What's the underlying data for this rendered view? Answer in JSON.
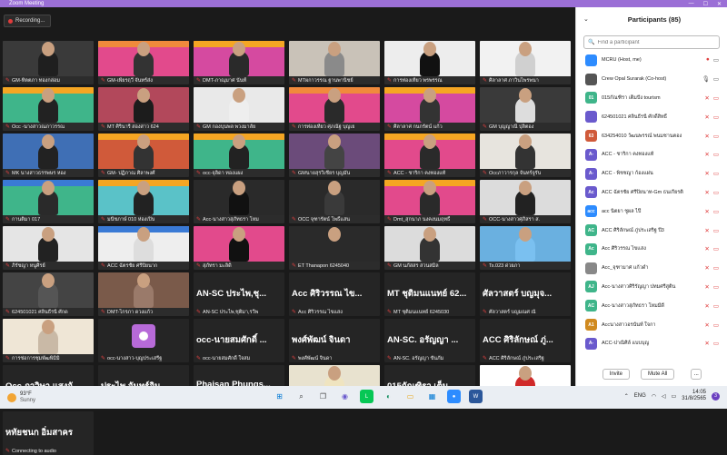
{
  "window": {
    "title": "Zoom Meeting"
  },
  "recording": {
    "label": "Recording..."
  },
  "tiles": [
    {
      "name": "GM-ทิตตภา ทองกล่อม",
      "type": "video",
      "bg": "#3a3a3a",
      "banner": "",
      "shirt": "#1f1f1f"
    },
    {
      "name": "GM-เพียรฤวี จันทร์ส่ง",
      "type": "video",
      "bg": "#e24a8c",
      "banner": "#f08a3c",
      "shirt": "#333"
    },
    {
      "name": "DMT-ภาณุมาศ นันท์ี",
      "type": "video",
      "bg": "#d54aa0",
      "banner": "#f5a623",
      "shirt": "#2a2a2a"
    },
    {
      "name": "MTผกาวรรณ ฐานพานิชย์",
      "type": "video",
      "bg": "#c9c2b8",
      "banner": "",
      "shirt": "#8a8a8a"
    },
    {
      "name": "การท่องเที่ยว พรพรรณ",
      "type": "video",
      "bg": "#ededed",
      "banner": "",
      "shirt": "#111"
    },
    {
      "name": "ศิลาลาศ ภาวินไพรพนา",
      "type": "video",
      "bg": "#f2f2f2",
      "banner": "",
      "shirt": "#d0d0d0"
    },
    {
      "name": "Occ -นางสาวณภาวรรณ",
      "type": "video",
      "bg": "#3fb58a",
      "banner": "#f5a623",
      "shirt": "#222"
    },
    {
      "name": "MT ศิรินารี สองสาว 624",
      "type": "video",
      "bg": "#b2485b",
      "banner": "",
      "shirt": "#1c1c1c"
    },
    {
      "name": "GM กองบุนพล พวงมาลัย",
      "type": "video",
      "bg": "#e9e9e9",
      "banner": "",
      "shirt": "#eee"
    },
    {
      "name": "การท่องเที่ยว ศุภณัฐ บุญเย",
      "type": "video",
      "bg": "#e24a8c",
      "banner": "#f08a3c",
      "shirt": "#2a2a2a"
    },
    {
      "name": "ศิลาลาศ กนกรัตน์ แก้ว",
      "type": "video",
      "bg": "#d54aa0",
      "banner": "#f5a623",
      "shirt": "#333"
    },
    {
      "name": "GM บุญญาณี ปุลิตอง",
      "type": "video",
      "bg": "#3a3a3a",
      "banner": "",
      "shirt": "#ddd"
    },
    {
      "name": "MK นางสาวธรรพษร หอง",
      "type": "video",
      "bg": "#3f6fb5",
      "banner": "",
      "shirt": "#222"
    },
    {
      "name": "GM- ปฏิภาณ ศิลาพงศ์",
      "type": "video",
      "bg": "#d05a3a",
      "banner": "#f5a623",
      "shirt": "#333"
    },
    {
      "name": "occ-จุลิดา ทองแผง",
      "type": "video",
      "bg": "#3fb58a",
      "banner": "#f5a623",
      "shirt": "#222"
    },
    {
      "name": "GMนายสุรวิเชียร บุญมั่น",
      "type": "video",
      "bg": "#6b4b7a",
      "banner": "",
      "shirt": "#444"
    },
    {
      "name": "ACC - ชาริกา คงทองแท้",
      "type": "video",
      "bg": "#e24a8c",
      "banner": "#f5a623",
      "shirt": "#2a2a2a"
    },
    {
      "name": "Occภาวารกุล จันทร์จูรัน",
      "type": "video",
      "bg": "#e7e4de",
      "banner": "",
      "shirt": "#333"
    },
    {
      "name": "กานติมา 017",
      "type": "video",
      "bg": "#3fb58a",
      "banner": "#3a7ad5",
      "shirt": "#2a2a2a"
    },
    {
      "name": "มนีชภาษ์ 010 ห่องเปิน",
      "type": "video",
      "bg": "#5ac2c8",
      "banner": "#f5a623",
      "shirt": "#222"
    },
    {
      "name": "Acc-นางสาวสุภัทธรา โหม",
      "type": "video",
      "bg": "#2a2a2a",
      "banner": "",
      "shirt": "#111"
    },
    {
      "name": "OCC จุฑารัตน์ โพธิ์แสน",
      "type": "video",
      "bg": "#2a2a2a",
      "banner": "",
      "shirt": "#3a3a3a"
    },
    {
      "name": "Dmt_สุกนาภ นงคงนมฤทธิ์",
      "type": "video",
      "bg": "#e24a8c",
      "banner": "#f5a623",
      "shirt": "#2a2a2a"
    },
    {
      "name": "OCC-นางสาวศุภิสรา ส.",
      "type": "video",
      "bg": "#dcdcdc",
      "banner": "",
      "shirt": "#222"
    },
    {
      "name": "ภิรัชญา หนูศิรย์",
      "type": "video",
      "bg": "#e5e5e5",
      "banner": "",
      "shirt": "#222"
    },
    {
      "name": "ACC ฉัตรชัย ศรีปิยนาก",
      "type": "video",
      "bg": "#eeeeee",
      "banner": "#3a7ad5",
      "shirt": "#ddd"
    },
    {
      "name": "สุภัทรา มะลิดิ",
      "type": "video",
      "bg": "#e24a8c",
      "banner": "",
      "shirt": "#111"
    },
    {
      "name": "ET Thanapon 6245040",
      "type": "video",
      "bg": "#2a2a2a",
      "banner": "",
      "shirt": "#2a2a2a"
    },
    {
      "name": "GM นภัสสร สวนสมิล",
      "type": "video",
      "bg": "#dcdcdc",
      "banner": "",
      "shirt": "#333"
    },
    {
      "name": "Ts.023 ด่วยภา",
      "type": "video",
      "bg": "#6ab0e0",
      "banner": "",
      "shirt": "#7ac0f0"
    },
    {
      "name": "624501021 ศลินธีรนี ศักด",
      "type": "video",
      "bg": "#444",
      "banner": "",
      "shirt": "#555"
    },
    {
      "name": "DMT-ไกรภา ดวงแก้ว",
      "type": "video",
      "bg": "#7a5a4a",
      "banner": "",
      "shirt": "#9a7a6a"
    },
    {
      "name": "AN-SC ประไพ,ชุติมา,รวีพ",
      "type": "text",
      "big": "AN-SC ประไพ,ชุ..."
    },
    {
      "name": "Acc ศิริวรรณ ไขแสง",
      "type": "text",
      "big": "Acc ศิริวรรณ ไข..."
    },
    {
      "name": "MT ชุติมนแนทย์ 6245030",
      "type": "text",
      "big": "MT ชุติมนแนทย์ 62..."
    },
    {
      "name": "ศัลวาสตร์ บญมณศ ณั",
      "type": "text",
      "big": "ศัลวาสตร์ บญมุจ..."
    },
    {
      "name": "การช่อการชุมพัฒพิมิมิ",
      "type": "video",
      "bg": "#efe6d6",
      "banner": "",
      "shirt": "#c9b9a6"
    },
    {
      "name": "occ-นางสาว-บุญประเสรีฐ",
      "type": "avatar"
    },
    {
      "name": "occ-นายสมศักดิ์ ใจสม",
      "type": "text",
      "big": "occ-นายสมศักดิ์ ..."
    },
    {
      "name": "พงศ์พัฒน์ จินดา",
      "type": "text",
      "big": "พงศ์พัฒน์ จินดา"
    },
    {
      "name": "AN-SC. อรัญญา ขันภัม",
      "type": "text",
      "big": "AN-SC. อรัญญา ..."
    },
    {
      "name": "ACC ศิริลักษณ์ ภู่ประเสริฐ",
      "type": "text",
      "big": "ACC ศิริลักษณ์ ภู่..."
    },
    {
      "name": "Occ ภาวิษา แสงจันทร์",
      "type": "text",
      "big": "Occ ภาวิษา แสงจั..."
    },
    {
      "name": "ประไพ จันทร์อินทร์ ศิลาศ",
      "type": "text",
      "big": "ประไพ จันทร์อิน..."
    },
    {
      "name": "Phaisan Phungsopha",
      "type": "text",
      "big": "Phaisan Phungs..."
    },
    {
      "name": "แก้ว017 การท่องเที่ยวและ",
      "type": "video",
      "bg": "#e8e2cf",
      "banner": "",
      "shirt": "#efe4c0"
    },
    {
      "name": "015กัณฑิรา เต็มปัง touris",
      "type": "text",
      "big": "015กัณฑิรา เต็ม..."
    },
    {
      "name": "Nong Poy Rattika",
      "type": "video",
      "bg": "#ffffff",
      "banner": "",
      "shirt": "#d02a2a"
    },
    {
      "name": "Connecting to audio",
      "type": "text",
      "big": "หทัยชนก อิ่มสาคร"
    }
  ],
  "participants_panel": {
    "title": "Participants (85)",
    "search_placeholder": "Find a participant",
    "participants": [
      {
        "initials": "",
        "name": "MCRU (Host, me)",
        "color": "#2d8cff",
        "mic": "rec",
        "cam": "on"
      },
      {
        "initials": "",
        "name": "Crew Opal Surarak (Co-host)",
        "color": "#555",
        "mic": "on",
        "cam": "on"
      },
      {
        "initials": "01",
        "name": "015กัณฑิรา เต็มปัง tourism",
        "color": "#3fb58a",
        "mic": "off",
        "cam": "off"
      },
      {
        "initials": "",
        "name": "624501021 ศลินธีรนี ศักดิ์สิทธิ์",
        "color": "#6a5acd",
        "mic": "off",
        "cam": "off"
      },
      {
        "initials": "63",
        "name": "634254010 วัฒนพรรณ์ พนมชานตอง",
        "color": "#d05a3a",
        "mic": "off",
        "cam": "off"
      },
      {
        "initials": "A-",
        "name": "ACC - ชาริกา คงทองแท้",
        "color": "#6a5acd",
        "mic": "off",
        "cam": "off"
      },
      {
        "initials": "A-",
        "name": "ACC - พิชชญา ก้องแผ่น",
        "color": "#6a5acd",
        "mic": "off",
        "cam": "off"
      },
      {
        "initials": "Ac",
        "name": "ACC ฉัตรชัย ศรีปิยนาท-Gm ธนเกียรติ",
        "color": "#6a5acd",
        "mic": "off",
        "cam": "off"
      },
      {
        "initials": "acc",
        "name": "acc นิตยา ชูผล ไป๊",
        "color": "#2d8cff",
        "mic": "off",
        "cam": "off"
      },
      {
        "initials": "AC",
        "name": "ACC ศิริลักษณ์ ภู่ประเสริฐ ปี3",
        "color": "#3fb58a",
        "mic": "off",
        "cam": "off"
      },
      {
        "initials": "Ac",
        "name": "Acc ศิริวรรณ ไขแสง",
        "color": "#3fb58a",
        "mic": "off",
        "cam": "off"
      },
      {
        "initials": "",
        "name": "Acc_จุฑามาศ แก้วดำ",
        "color": "#888",
        "mic": "off",
        "cam": "off"
      },
      {
        "initials": "AJ",
        "name": "Acc-นางสาวศิริรัญญา ปทมศรีสูติน",
        "color": "#3fb58a",
        "mic": "off",
        "cam": "off"
      },
      {
        "initials": "AC",
        "name": "Acc-นางสาวสุภัทธรา โหมมีดี",
        "color": "#3fb58a",
        "mic": "off",
        "cam": "off"
      },
      {
        "initials": "A1",
        "name": "Accนางสาวอรนันท์ ใจกา",
        "color": "#d08a20",
        "mic": "off",
        "cam": "off"
      },
      {
        "initials": "A-",
        "name": "ACC-ปาณิศิล์ แบบบุญ",
        "color": "#6a5acd",
        "mic": "off",
        "cam": "off"
      }
    ],
    "invite_label": "Invite",
    "mute_all_label": "Mute All",
    "more_label": "..."
  },
  "taskbar": {
    "temperature": "93°F",
    "weather": "Sunny",
    "lang": "ENG",
    "time": "14:05",
    "date": "31/8/2565",
    "notifications": "3"
  }
}
